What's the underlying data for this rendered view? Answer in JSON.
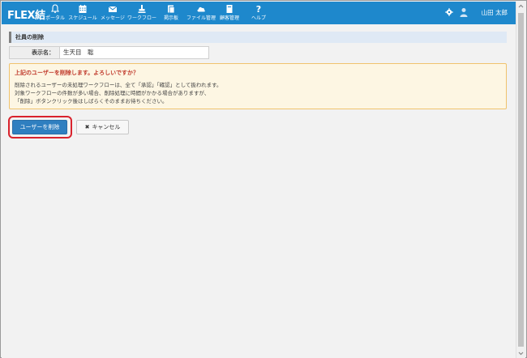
{
  "header": {
    "logo": "FLEX結",
    "nav": [
      {
        "label": "ポータル",
        "icon": "bell-icon"
      },
      {
        "label": "スケジュール",
        "icon": "calendar-icon"
      },
      {
        "label": "メッセージ",
        "icon": "envelope-icon"
      },
      {
        "label": "ワークフロー",
        "icon": "stamp-icon"
      },
      {
        "label": "掲示板",
        "icon": "bulletin-icon"
      },
      {
        "label": "ファイル管理",
        "icon": "cloud-icon"
      },
      {
        "label": "顧客管理",
        "icon": "book-icon"
      },
      {
        "label": "ヘルプ",
        "icon": "question-icon"
      }
    ],
    "user_name": "山田 太郎"
  },
  "main": {
    "section_title": "社員の削除",
    "field_label": "表示名：",
    "field_value": "生天目　聡",
    "warning": {
      "title": "上記のユーザーを削除します。よろしいですか？",
      "lines": [
        "削除されるユーザーの未処理ワークフローは、全て「承認」「確認」として扱われます。",
        "対象ワークフローの件数が多い場合、削除処理に時間がかかる場合がありますが、",
        "「削除」ボタンクリック後はしばらくそのままお待ちください。"
      ]
    },
    "delete_button": "ユーザーを削除",
    "cancel_button": "キャンセル"
  },
  "colors": {
    "header_bg": "#1e88cc",
    "primary_button": "#2f7fc0",
    "highlight_border": "#d9232d",
    "warning_bg": "#fdf6e3",
    "warning_title": "#c0392b"
  }
}
